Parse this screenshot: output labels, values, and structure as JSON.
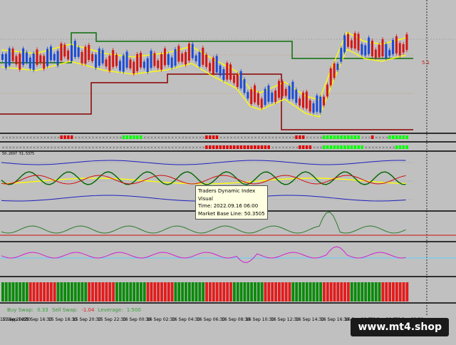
{
  "tooltip": {
    "name": "Traders Dynamic Index",
    "visual": "Visual",
    "time": "Time: 2022.09.16 06:00",
    "value": "Market Base Line: 50.3505"
  },
  "swap": {
    "buy_label": "Buy Swap:",
    "buy_value": "0.33",
    "sell_label": "Sell Swap:",
    "sell_value": "-1.04",
    "leverage_label": "Leverage:",
    "leverage_value": "1:500"
  },
  "time_axis": [
    "15 Sep 2022",
    "15 Sep 14:30",
    "15 Sep 16:30",
    "15 Sep 18:30",
    "15 Sep 20:30",
    "15 Sep 22:30",
    "16 Sep 00:30",
    "16 Sep 02:30",
    "16 Sep 04:30",
    "16 Sep 06:30",
    "16 Sep 08:30",
    "16 Sep 10:30",
    "16 Sep 12:30",
    "16 Sep 14:30",
    "16 Sep 16:30",
    "16 Sep 18:30",
    "16 Sep 20:30",
    "16 Sep 22:30"
  ],
  "indicator_title": "50.2697 51.5375",
  "price_marker": "5.1",
  "watermark": "www.mt4.shop",
  "colors": {
    "background": "#c0c0c0",
    "bull": "#1a4bd6",
    "bear": "#d41515",
    "green_line": "#0a6e0a",
    "darkred_line": "#8b0000",
    "yellow": "#ffff00",
    "lime": "#00ff00"
  }
}
